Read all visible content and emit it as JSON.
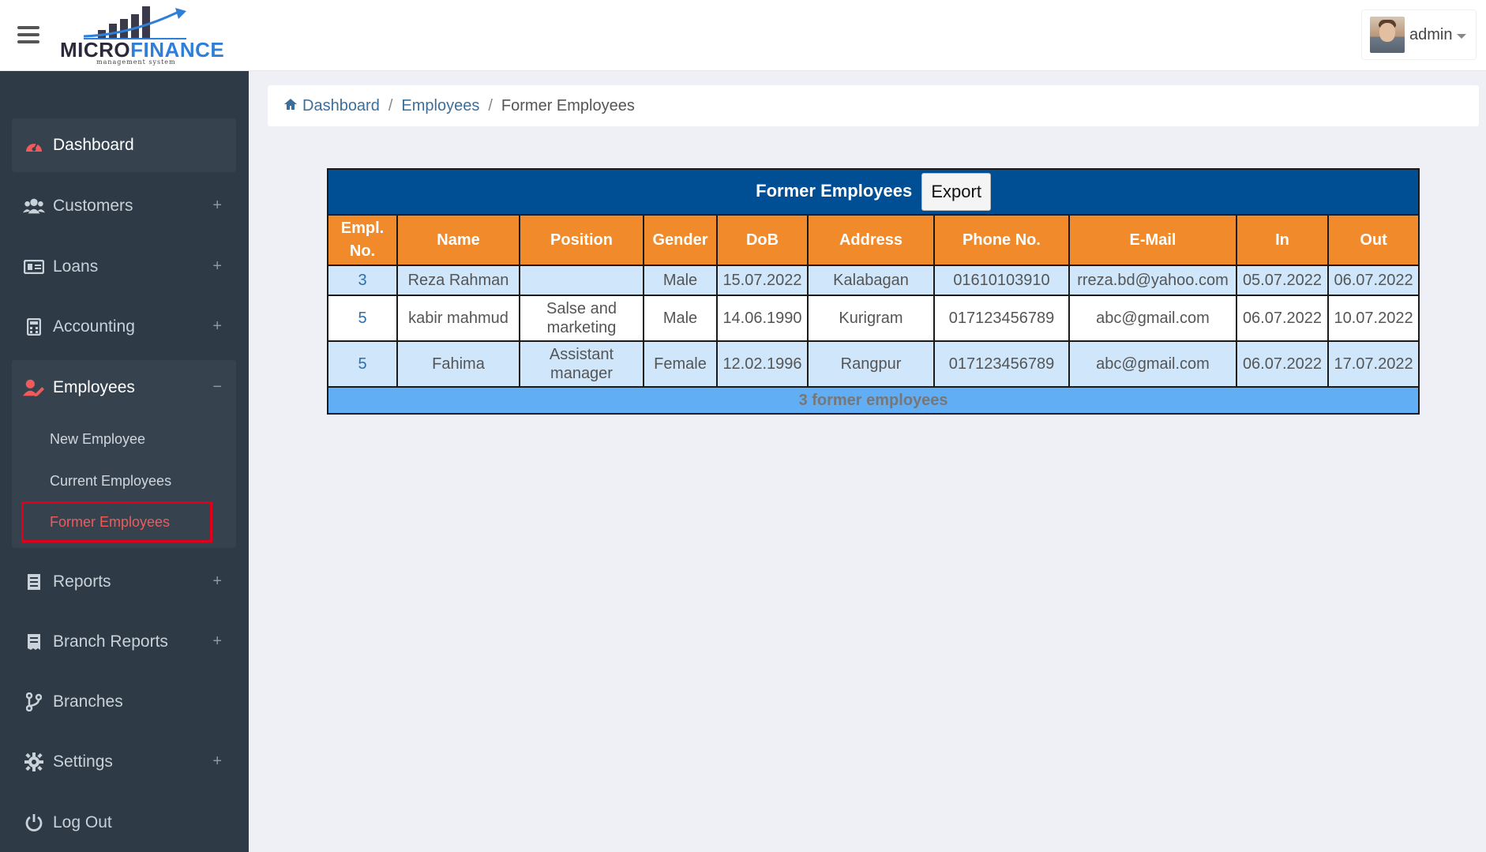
{
  "header": {
    "logo_main": "MICRO",
    "logo_accent": "FINANCE",
    "logo_sub": "management system",
    "user_name": "admin"
  },
  "sidebar": {
    "items": [
      {
        "label": "Dashboard",
        "icon": "dashboard-icon"
      },
      {
        "label": "Customers",
        "icon": "users-icon",
        "expand": "+"
      },
      {
        "label": "Loans",
        "icon": "money-icon",
        "expand": "+"
      },
      {
        "label": "Accounting",
        "icon": "calculator-icon",
        "expand": "+"
      },
      {
        "label": "Employees",
        "icon": "user-edit-icon",
        "expand": "−"
      },
      {
        "label": "Reports",
        "icon": "report-icon",
        "expand": "+"
      },
      {
        "label": "Branch Reports",
        "icon": "receipt-icon",
        "expand": "+"
      },
      {
        "label": "Branches",
        "icon": "branch-icon"
      },
      {
        "label": "Settings",
        "icon": "gear-icon",
        "expand": "+"
      },
      {
        "label": "Log Out",
        "icon": "power-icon"
      }
    ],
    "employee_sub": [
      "New Employee",
      "Current Employees",
      "Former Employees"
    ]
  },
  "breadcrumb": {
    "home": "Dashboard",
    "section": "Employees",
    "current": "Former Employees",
    "separator": "/"
  },
  "table": {
    "title": "Former Employees",
    "export_label": "Export",
    "columns": [
      "Empl. No.",
      "Name",
      "Position",
      "Gender",
      "DoB",
      "Address",
      "Phone No.",
      "E-Mail",
      "In",
      "Out"
    ],
    "rows": [
      [
        "3",
        "Reza Rahman",
        "",
        "Male",
        "15.07.2022",
        "Kalabagan",
        "01610103910",
        "rreza.bd@yahoo.com",
        "05.07.2022",
        "06.07.2022"
      ],
      [
        "5",
        "kabir mahmud",
        "Salse and marketing",
        "Male",
        "14.06.1990",
        "Kurigram",
        "017123456789",
        "abc@gmail.com",
        "06.07.2022",
        "10.07.2022"
      ],
      [
        "5",
        "Fahima",
        "Assistant manager",
        "Female",
        "12.02.1996",
        "Rangpur",
        "017123456789",
        "abc@gmail.com",
        "06.07.2022",
        "17.07.2022"
      ]
    ],
    "footer": "3 former employees"
  },
  "colors": {
    "sidebar_bg": "#2e3a45",
    "table_title_bg": "#004f94",
    "header_bg": "#f08a2b",
    "row_blue": "#cfe6fb",
    "footer_bg": "#62aef5",
    "accent_red": "#f05a5a"
  }
}
